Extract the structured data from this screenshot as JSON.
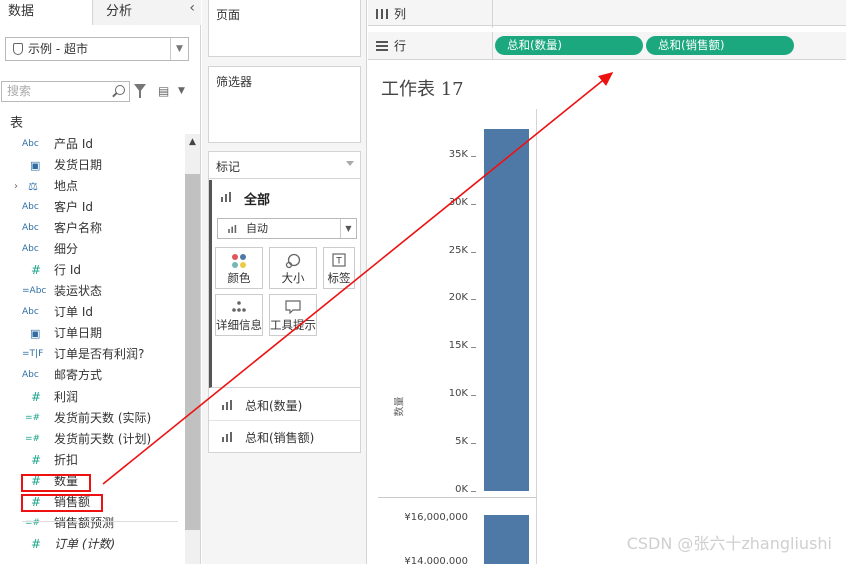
{
  "tabs": {
    "data": "数据",
    "analysis": "分析"
  },
  "datasource": {
    "name": "示例 - 超市"
  },
  "search": {
    "placeholder": "搜索"
  },
  "section_title": "表",
  "fields": [
    {
      "type": "Abc",
      "label": "产品 Id",
      "kind": "dimension-string"
    },
    {
      "type": "date",
      "label": "发货日期",
      "kind": "dimension-date"
    },
    {
      "type": "geo",
      "label": "地点",
      "kind": "hierarchy"
    },
    {
      "type": "Abc",
      "label": "客户 Id",
      "kind": "dimension-string"
    },
    {
      "type": "Abc",
      "label": "客户名称",
      "kind": "dimension-string"
    },
    {
      "type": "Abc",
      "label": "细分",
      "kind": "dimension-string"
    },
    {
      "type": "#",
      "label": "行 Id",
      "kind": "dimension-number"
    },
    {
      "type": "=Abc",
      "label": "装运状态",
      "kind": "calc-string"
    },
    {
      "type": "Abc",
      "label": "订单 Id",
      "kind": "dimension-string"
    },
    {
      "type": "date",
      "label": "订单日期",
      "kind": "dimension-date"
    },
    {
      "type": "=T|F",
      "label": "订单是否有利润?",
      "kind": "calc-bool"
    },
    {
      "type": "Abc",
      "label": "邮寄方式",
      "kind": "dimension-string"
    },
    {
      "type": "#",
      "label": "利润",
      "kind": "measure"
    },
    {
      "type": "=#",
      "label": "发货前天数 (实际)",
      "kind": "calc-measure"
    },
    {
      "type": "=#",
      "label": "发货前天数 (计划)",
      "kind": "calc-measure"
    },
    {
      "type": "#",
      "label": "折扣",
      "kind": "measure"
    },
    {
      "type": "#",
      "label": "数量",
      "kind": "measure"
    },
    {
      "type": "#",
      "label": "销售额",
      "kind": "measure"
    },
    {
      "type": "=#",
      "label": "销售额预测",
      "kind": "calc-measure"
    },
    {
      "type": "#",
      "label": "订单 (计数)",
      "kind": "measure-italic"
    }
  ],
  "cards": {
    "pages": "页面",
    "filters": "筛选器",
    "marks": "标记",
    "marks_all": "全部",
    "mark_type": "自动",
    "color": "颜色",
    "size": "大小",
    "label": "标签",
    "detail": "详细信息",
    "tooltip": "工具提示",
    "pill_quantity": "总和(数量)",
    "pill_sales": "总和(销售额)"
  },
  "shelves": {
    "columns": "列",
    "rows": "行",
    "row_pills": [
      "总和(数量)",
      "总和(销售额)"
    ]
  },
  "sheet_title": "工作表 17",
  "axis_title": "数量",
  "chart_data": {
    "type": "bar",
    "series": [
      {
        "name": "总和(数量)",
        "values": [
          37800
        ]
      },
      {
        "name": "总和(销售额)",
        "values": [
          16000000
        ]
      }
    ],
    "axes": [
      {
        "ticks": [
          "0K",
          "5K",
          "10K",
          "15K",
          "20K",
          "25K",
          "30K",
          "35K"
        ],
        "range": [
          0,
          38000
        ]
      },
      {
        "ticks": [
          "¥16,000,000",
          "¥14,000,000"
        ]
      }
    ]
  },
  "colors": {
    "bar": "#4e79a7",
    "pill": "#1ba87f",
    "annotation": "#e11111"
  },
  "watermark": "CSDN @张六十zhangliushi"
}
